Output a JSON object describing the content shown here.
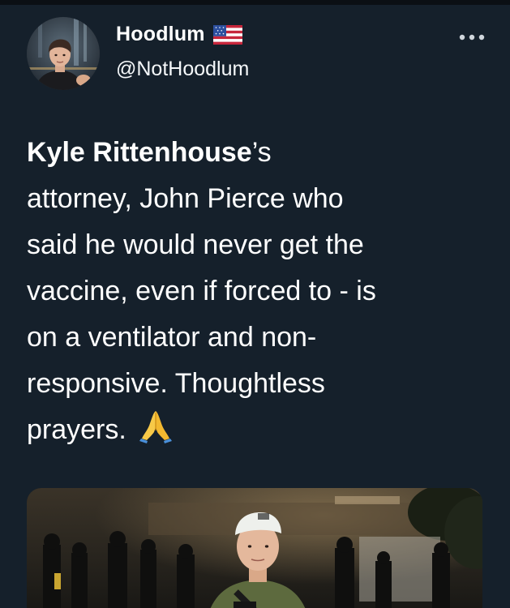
{
  "tweet": {
    "author": {
      "display_name": "Hoodlum",
      "handle": "@NotHoodlum",
      "badge": "us-flag-emoji",
      "avatar": "avatar-photo"
    },
    "more_icon": "ellipsis-icon",
    "text": {
      "bold_name": "Kyle Rittenhouse",
      "line1_rest": "’s",
      "line2": "attorney, John Pierce who",
      "line3": "said he would never get the",
      "line4": "vaccine, even if forced to - is",
      "line5": "on a ventilator and non-",
      "line6": "responsive. Thoughtless",
      "line7": "prayers."
    },
    "emoji": "folded-hands-emoji",
    "media": "photo-man-at-night-protest"
  },
  "colors": {
    "background": "#15202b",
    "text": "#ffffff",
    "secondary_text": "#f5f8fa"
  }
}
